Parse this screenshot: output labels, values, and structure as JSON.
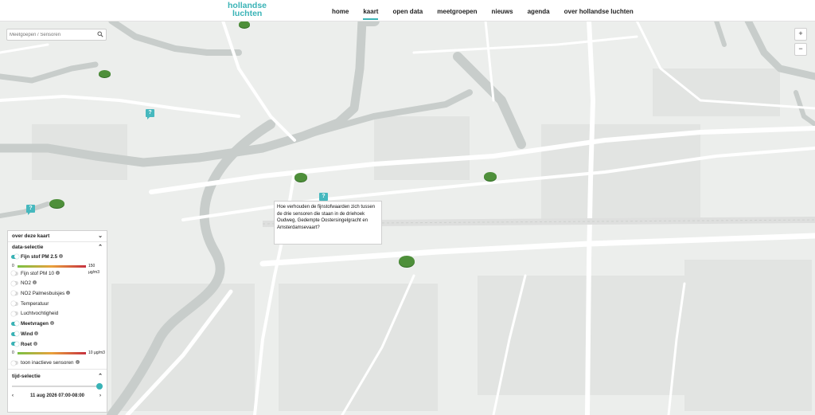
{
  "header": {
    "logo_line1": "hollandse",
    "logo_line2": "luchten",
    "nav": [
      {
        "label": "home",
        "active": false
      },
      {
        "label": "kaart",
        "active": true
      },
      {
        "label": "open data",
        "active": false
      },
      {
        "label": "meetgroepen",
        "active": false
      },
      {
        "label": "nieuws",
        "active": false
      },
      {
        "label": "agenda",
        "active": false
      },
      {
        "label": "over hollandse luchten",
        "active": false
      }
    ]
  },
  "search": {
    "placeholder": "Meetgoepen / Sensoren",
    "value": ""
  },
  "zoom": {
    "in": "+",
    "out": "−"
  },
  "tooltip": {
    "text": "Hoe verhouden de fijnstofwaarden zich tussen de drie sensoren die staan in de driehoek Oudweg, Gedempte Oostersingelgracht en Amsterdamsevaart?"
  },
  "question_icon": "?",
  "panel": {
    "about": {
      "label": "over deze kaart",
      "chevron": "⌄"
    },
    "data_selection": {
      "label": "data-selectie",
      "chevron": "⌃"
    },
    "layers": [
      {
        "label": "Fijn stof PM 2.5",
        "on": true,
        "info": true
      },
      {
        "label": "Fijn stof PM 10",
        "on": false,
        "info": true
      },
      {
        "label": "NO2",
        "on": false,
        "info": true
      },
      {
        "label": "NO2 Palmesbuisjes",
        "on": false,
        "info": true
      },
      {
        "label": "Temperatuur",
        "on": false,
        "info": false
      },
      {
        "label": "Luchtvochtigheid",
        "on": false,
        "info": false
      },
      {
        "label": "Meetvragen",
        "on": true,
        "info": true
      },
      {
        "label": "Wind",
        "on": true,
        "info": true
      },
      {
        "label": "Roet",
        "on": true,
        "info": true
      }
    ],
    "pm25_scale": {
      "min": "0",
      "max": "150 µg/m3"
    },
    "roet_scale": {
      "min": "0",
      "max": "10 µg/m3"
    },
    "inactive": {
      "label": "toon inactieve sensoren",
      "on": false
    },
    "time_selection": {
      "label": "tijd-selectie",
      "chevron": "⌃",
      "slider_value": 1.0
    },
    "time": {
      "value": "11 aug 2026 07:00-08:00",
      "prev": "‹",
      "next": "›"
    }
  },
  "colors": {
    "accent": "#39b3b6",
    "sensor": "#4e8f3a",
    "question": "#46b8be",
    "water": "#c8cdcb",
    "road": "#ffffff"
  }
}
